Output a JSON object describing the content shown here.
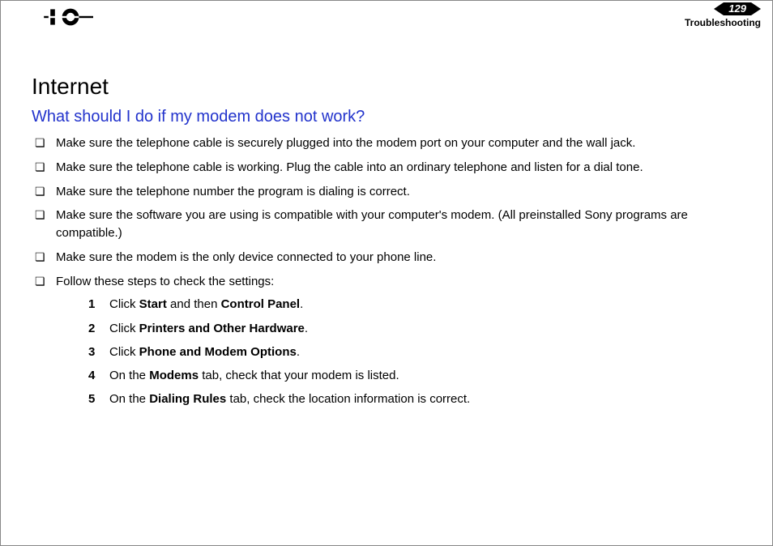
{
  "header": {
    "page_number": "129",
    "section": "Troubleshooting"
  },
  "title": "Internet",
  "question": "What should I do if my modem does not work?",
  "bullets": [
    "Make sure the telephone cable is securely plugged into the modem port on your computer and the wall jack.",
    "Make sure the telephone cable is working. Plug the cable into an ordinary telephone and listen for a dial tone.",
    "Make sure the telephone number the program is dialing is correct.",
    "Make sure the software you are using is compatible with your computer's modem. (All preinstalled Sony programs are compatible.)",
    "Make sure the modem is the only device connected to your phone line.",
    "Follow these steps to check the settings:"
  ],
  "steps": [
    {
      "pre": "Click ",
      "b1": "Start",
      "mid": " and then ",
      "b2": "Control Panel",
      "post": "."
    },
    {
      "pre": "Click ",
      "b1": "Printers and Other Hardware",
      "mid": "",
      "b2": "",
      "post": "."
    },
    {
      "pre": "Click ",
      "b1": "Phone and Modem Options",
      "mid": "",
      "b2": "",
      "post": "."
    },
    {
      "pre": "On the ",
      "b1": "Modems",
      "mid": " tab, check that your modem is listed.",
      "b2": "",
      "post": ""
    },
    {
      "pre": "On the ",
      "b1": "Dialing Rules",
      "mid": " tab, check the location information is correct.",
      "b2": "",
      "post": ""
    }
  ]
}
